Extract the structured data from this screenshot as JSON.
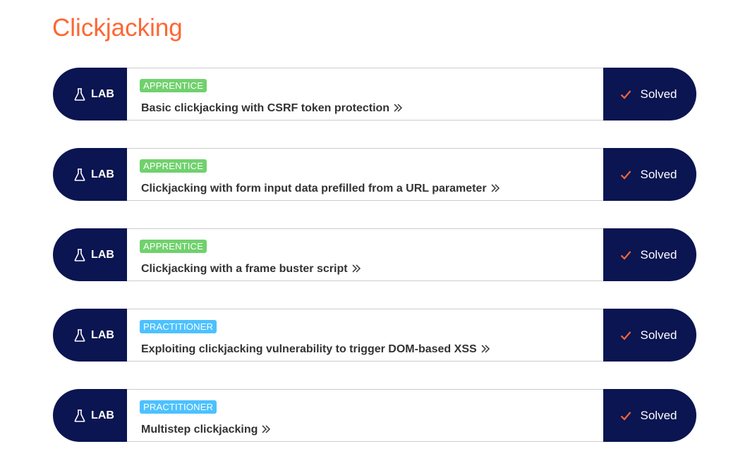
{
  "page": {
    "title": "Clickjacking"
  },
  "colors": {
    "accent": "#ff6633",
    "navy": "#0a1551",
    "apprentice": "#70d16d",
    "practitioner": "#4cc1ff"
  },
  "labs": [
    {
      "badge_label": "LAB",
      "badge_icon": "flask-icon",
      "level": "APPRENTICE",
      "title": "Basic clickjacking with CSRF token protection",
      "status": "Solved",
      "status_icon": "check-icon"
    },
    {
      "badge_label": "LAB",
      "badge_icon": "flask-icon",
      "level": "APPRENTICE",
      "title": "Clickjacking with form input data prefilled from a URL parameter",
      "status": "Solved",
      "status_icon": "check-icon"
    },
    {
      "badge_label": "LAB",
      "badge_icon": "flask-icon",
      "level": "APPRENTICE",
      "title": "Clickjacking with a frame buster script",
      "status": "Solved",
      "status_icon": "check-icon"
    },
    {
      "badge_label": "LAB",
      "badge_icon": "flask-icon",
      "level": "PRACTITIONER",
      "title": "Exploiting clickjacking vulnerability to trigger DOM-based XSS",
      "status": "Solved",
      "status_icon": "check-icon"
    },
    {
      "badge_label": "LAB",
      "badge_icon": "flask-icon",
      "level": "PRACTITIONER",
      "title": "Multistep clickjacking",
      "status": "Solved",
      "status_icon": "check-icon"
    }
  ]
}
